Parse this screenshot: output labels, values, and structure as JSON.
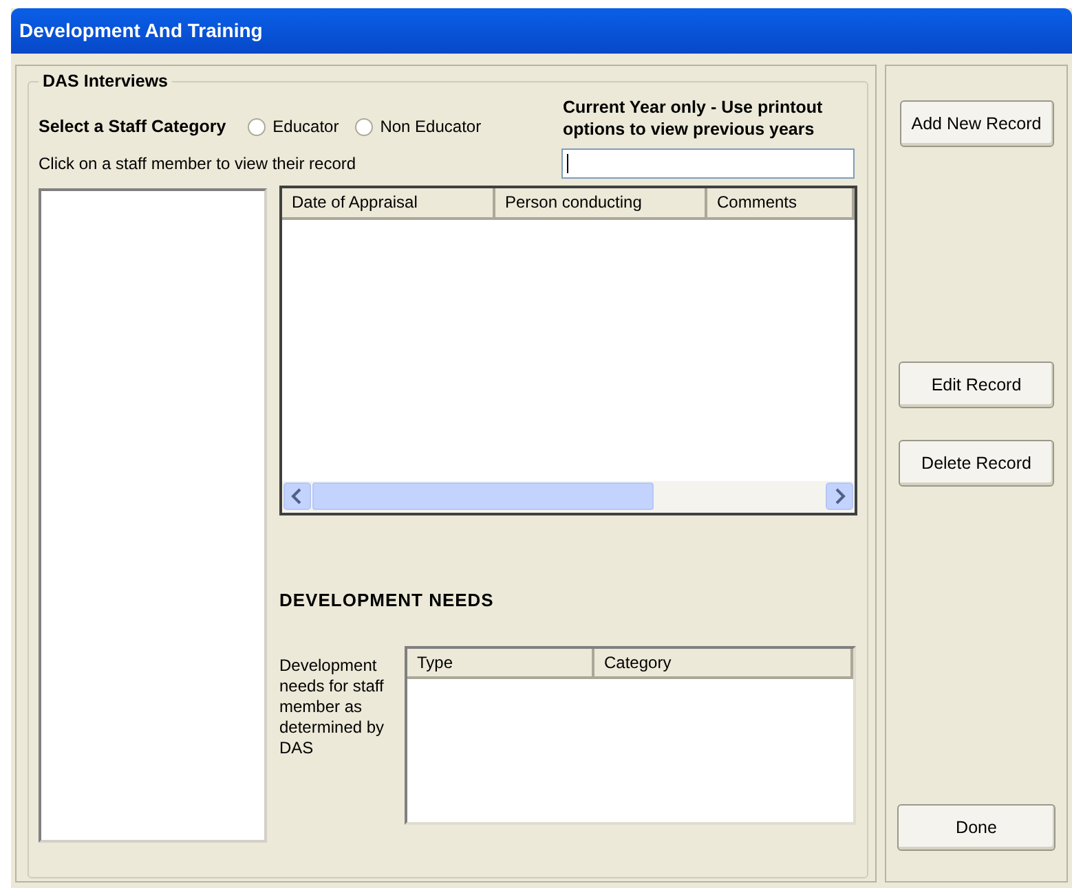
{
  "window": {
    "title": "Development And Training"
  },
  "group": {
    "title": "DAS Interviews"
  },
  "staff_category": {
    "label": "Select a Staff Category",
    "options": [
      {
        "label": "Educator",
        "selected": false
      },
      {
        "label": "Non Educator",
        "selected": false
      }
    ]
  },
  "notice": "Current Year only - Use printout options to view previous years",
  "instruction": "Click on a staff member to view their record",
  "appraisals": {
    "columns": [
      "Date of Appraisal",
      "Person conducting",
      "Comments"
    ]
  },
  "development_needs": {
    "heading": "DEVELOPMENT NEEDS",
    "description": "Development needs for staff member as determined by DAS",
    "columns": [
      "Type",
      "Category"
    ]
  },
  "buttons": [
    {
      "label": "Add New Record"
    },
    {
      "label": "Edit Record"
    },
    {
      "label": "Delete Record"
    },
    {
      "label": "Done"
    }
  ]
}
